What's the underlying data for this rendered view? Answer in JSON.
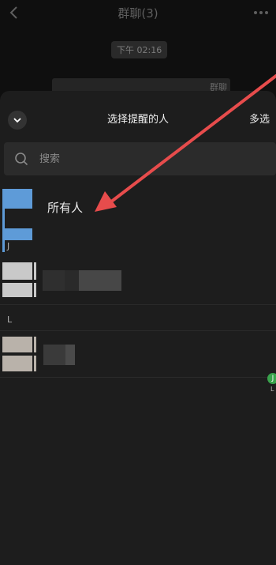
{
  "chat": {
    "title": "群聊(3)",
    "time_pill": "下午 02:16",
    "bg_message_tail": "群聊"
  },
  "sheet": {
    "title": "选择提醒的人",
    "multi_select_label": "多选",
    "search": {
      "placeholder": "搜索",
      "value": ""
    },
    "everyone_label": "所有人",
    "sections": [
      {
        "letter": "J"
      },
      {
        "letter": "L"
      }
    ]
  },
  "badge": {
    "letter": "J",
    "sub": "L"
  },
  "colors": {
    "accent_blue": "#6aa6e0",
    "arrow_red": "#e74c4c",
    "badge_green": "#39a34c"
  },
  "icons": [
    "back-icon",
    "more-icon",
    "chevron-down-icon",
    "search-icon"
  ]
}
